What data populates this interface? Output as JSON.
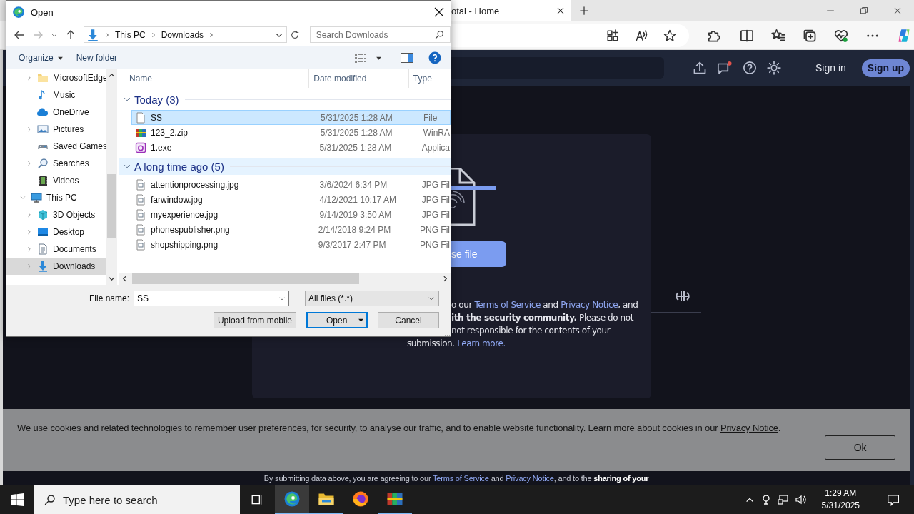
{
  "browser": {
    "tab": {
      "title": "otal - Home"
    },
    "site_header": {
      "sign_in": "Sign in",
      "sign_up": "Sign up"
    },
    "upload_card": {
      "button": "se file",
      "terms": [
        [
          {
            "text": "o our "
          },
          {
            "link": "Terms of Service"
          },
          {
            "text": " and "
          },
          {
            "link": "Privacy Notice"
          },
          {
            "text": ", and"
          }
        ],
        [
          {
            "text": "**ith the security community.** Please do not"
          }
        ],
        [
          {
            "text": "not responsible for the contents of your"
          }
        ],
        [
          {
            "text": "submission. "
          },
          {
            "link": "Learn more."
          }
        ]
      ]
    },
    "cookie_banner": {
      "segments": [
        {
          "text": "We use cookies and related technologies to remember user preferences, for security, to analyse our traffic, and to enable website functionality. Learn more about cookies in our "
        },
        {
          "link": "Privacy Notice"
        },
        {
          "text": "."
        }
      ],
      "button": "Ok"
    },
    "footer_note": {
      "segments": [
        {
          "text": "By submitting data above, you are agreeing to our "
        },
        {
          "link": "Terms of Service"
        },
        {
          "text": " and "
        },
        {
          "link": "Privacy Notice"
        },
        {
          "text": ", and to the **sharing of your**"
        }
      ]
    }
  },
  "dialog": {
    "title": "Open",
    "address": [
      "This PC",
      "Downloads"
    ],
    "search": {
      "placeholder": "Search Downloads"
    },
    "commands": [
      {
        "label": "Organize",
        "kind": "menu"
      },
      {
        "label": "New folder",
        "kind": "plain"
      }
    ],
    "nav_tree": [
      {
        "children": [
          {
            "label": "MicrosoftEdge",
            "kind": "folder",
            "expandable": true,
            "expanded": false,
            "selected": false
          },
          {
            "label": "Music",
            "kind": "music",
            "expandable": false,
            "selected": false
          },
          {
            "label": "OneDrive",
            "kind": "cloud",
            "expandable": false,
            "selected": false
          },
          {
            "label": "Pictures",
            "kind": "pictures",
            "expandable": true,
            "expanded": false,
            "selected": false
          },
          {
            "label": "Saved Games",
            "kind": "games",
            "expandable": false,
            "selected": false
          },
          {
            "label": "Searches",
            "kind": "search",
            "expandable": true,
            "expanded": false,
            "selected": false
          },
          {
            "label": "Videos",
            "kind": "videos",
            "expandable": false,
            "selected": false
          }
        ]
      },
      {
        "label": "This PC",
        "kind": "computer",
        "expandable": true,
        "expanded": true,
        "selected": false,
        "children": [
          {
            "label": "3D Objects",
            "kind": "cube",
            "expandable": true,
            "expanded": false,
            "selected": false
          },
          {
            "label": "Desktop",
            "kind": "desktop",
            "expandable": true,
            "expanded": false,
            "selected": false
          },
          {
            "label": "Documents",
            "kind": "documents",
            "expandable": true,
            "expanded": false,
            "selected": false
          },
          {
            "label": "Downloads",
            "kind": "downloads",
            "expandable": true,
            "expanded": false,
            "selected": true
          }
        ]
      }
    ],
    "columns": [
      "Name",
      "Date modified",
      "Type"
    ],
    "groups": [
      {
        "label": "Today (3)",
        "hovered": false,
        "files": [
          {
            "name": "SS",
            "date": "5/31/2025 1:28 AM",
            "type": "File",
            "kind": "blank",
            "selected": true
          },
          {
            "name": "123_2.zip",
            "date": "5/31/2025 1:28 AM",
            "type": "WinRA",
            "kind": "archive",
            "selected": false
          },
          {
            "name": "1.exe",
            "date": "5/31/2025 1:28 AM",
            "type": "Applica",
            "kind": "exe",
            "selected": false
          }
        ]
      },
      {
        "label": "A long time ago (5)",
        "hovered": true,
        "files": [
          {
            "name": "attentionprocessing.jpg",
            "date": "3/6/2024 6:34 PM",
            "type": "JPG Fil",
            "kind": "image",
            "selected": false
          },
          {
            "name": "farwindow.jpg",
            "date": "4/12/2021 10:17 AM",
            "type": "JPG Fil",
            "kind": "image",
            "selected": false
          },
          {
            "name": "myexperience.jpg",
            "date": "9/14/2019 3:50 AM",
            "type": "JPG Fil",
            "kind": "image",
            "selected": false
          },
          {
            "name": "phonespublisher.png",
            "date": "2/14/2018 9:24 PM",
            "type": "PNG Fil",
            "kind": "image",
            "selected": false
          },
          {
            "name": "shopshipping.png",
            "date": "9/3/2017 2:47 PM",
            "type": "PNG Fil",
            "kind": "image",
            "selected": false
          }
        ]
      }
    ],
    "file_name_label": "File name:",
    "file_name": {
      "value": "SS"
    },
    "file_type": {
      "value": "All files (*.*)"
    },
    "buttons": [
      {
        "label": "Upload from mobile",
        "kind": "plain",
        "default": false
      },
      {
        "label": "Open",
        "kind": "split",
        "default": true
      },
      {
        "label": "Cancel",
        "kind": "plain",
        "default": false
      }
    ]
  },
  "taskbar": {
    "search": {
      "placeholder": "Type here to search"
    },
    "apps": [
      {
        "kind": "edge",
        "active": true,
        "running": true
      },
      {
        "kind": "explorer",
        "active": false,
        "running": true
      },
      {
        "kind": "firefox",
        "active": false,
        "running": false
      },
      {
        "kind": "winrar",
        "active": false,
        "running": true
      }
    ],
    "time": "1:29 AM",
    "date": "5/31/2025"
  }
}
